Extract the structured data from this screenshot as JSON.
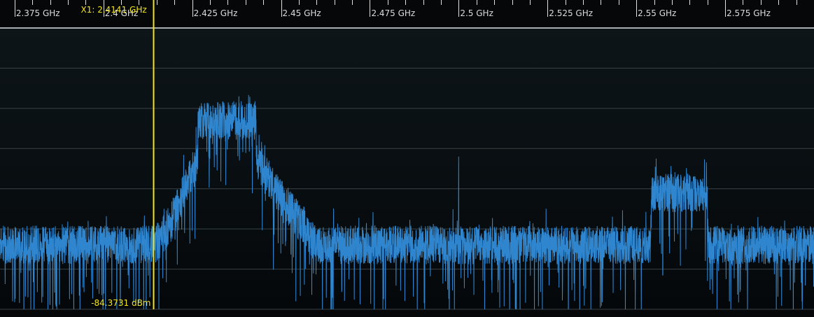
{
  "colors": {
    "background": "#050709",
    "plot_background_top": "#0d1519",
    "plot_background_bottom": "#05080a",
    "trace": "#2f86cf",
    "grid": "#3a4246",
    "reference_line": "#a7adb1",
    "ticks": "#e0e0e0",
    "tick_text": "#dcdcdc",
    "marker": "#f2e51b"
  },
  "marker": {
    "name": "X1",
    "frequency_ghz": 2.4141,
    "frequency_label": "X1: 2.4141 GHz",
    "level_label": "-84.3731 dBm"
  },
  "chart_data": {
    "type": "line",
    "xlabel": "",
    "ylabel": "",
    "xlim_ghz": [
      2.3709,
      2.6
    ],
    "x_tick_labels": [
      {
        "value": 2.375,
        "label": "2.375 GHz"
      },
      {
        "value": 2.4,
        "label": "2.4 GHz"
      },
      {
        "value": 2.425,
        "label": "2.425 GHz"
      },
      {
        "value": 2.45,
        "label": "2.45 GHz"
      },
      {
        "value": 2.475,
        "label": "2.475 GHz"
      },
      {
        "value": 2.5,
        "label": "2.5 GHz"
      },
      {
        "value": 2.525,
        "label": "2.525 GHz"
      },
      {
        "value": 2.55,
        "label": "2.55 GHz"
      },
      {
        "value": 2.575,
        "label": "2.575 GHz"
      }
    ],
    "minor_tick_step_ghz": 0.005,
    "ylim_dbm": [
      -90,
      -20
    ],
    "grid_lines_dbm": [
      -30,
      -40,
      -50,
      -60,
      -70,
      -80
    ],
    "reference_level_dbm": -20,
    "noise_floor_dbm": -74,
    "noise_spread_db": 6,
    "signals": [
      {
        "start_ghz": 2.4266,
        "end_ghz": 2.443,
        "level_dbm": -43,
        "skirt_start_ghz": 2.4141,
        "skirt_end_ghz": 2.46
      },
      {
        "start_ghz": 2.5542,
        "end_ghz": 2.57,
        "level_dbm": -61,
        "skirt_start_ghz": 2.5535,
        "skirt_end_ghz": 2.5705
      }
    ],
    "spurs": [
      {
        "frequency_ghz": 2.5,
        "level_dbm": -52
      }
    ]
  }
}
